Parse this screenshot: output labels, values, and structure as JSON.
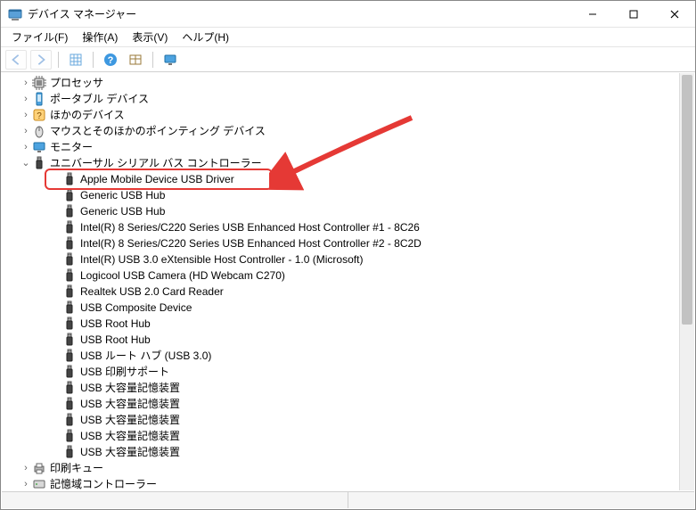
{
  "window": {
    "title": "デバイス マネージャー"
  },
  "menu": {
    "file": "ファイル(F)",
    "action": "操作(A)",
    "view": "表示(V)",
    "help": "ヘルプ(H)"
  },
  "toolbar_icons": {
    "back": "back-arrow",
    "fwd": "forward-arrow",
    "grid": "grid-icon",
    "help": "help-icon",
    "grid2": "grid2-icon",
    "monitor": "monitor-icon"
  },
  "tree": {
    "items": [
      {
        "expander": "collapsed",
        "icon": "cpu-icon",
        "label": "プロセッサ"
      },
      {
        "expander": "collapsed",
        "icon": "portable-icon",
        "label": "ポータブル デバイス"
      },
      {
        "expander": "collapsed",
        "icon": "unknown-icon",
        "label": "ほかのデバイス"
      },
      {
        "expander": "collapsed",
        "icon": "mouse-icon",
        "label": "マウスとそのほかのポインティング デバイス"
      },
      {
        "expander": "collapsed",
        "icon": "monitor-icon",
        "label": "モニター"
      },
      {
        "expander": "expanded",
        "icon": "usb-icon",
        "label": "ユニバーサル シリアル バス コントローラー",
        "children": [
          {
            "icon": "usb-icon",
            "label": "Apple Mobile Device USB Driver",
            "highlight": true
          },
          {
            "icon": "usb-icon",
            "label": "Generic USB Hub"
          },
          {
            "icon": "usb-icon",
            "label": "Generic USB Hub"
          },
          {
            "icon": "usb-icon",
            "label": "Intel(R) 8 Series/C220 Series USB Enhanced Host Controller #1 - 8C26"
          },
          {
            "icon": "usb-icon",
            "label": "Intel(R) 8 Series/C220 Series USB Enhanced Host Controller #2 - 8C2D"
          },
          {
            "icon": "usb-icon",
            "label": "Intel(R) USB 3.0 eXtensible Host Controller - 1.0 (Microsoft)"
          },
          {
            "icon": "usb-icon",
            "label": "Logicool USB Camera (HD Webcam C270)"
          },
          {
            "icon": "usb-icon",
            "label": "Realtek USB 2.0 Card Reader"
          },
          {
            "icon": "usb-icon",
            "label": "USB Composite Device"
          },
          {
            "icon": "usb-icon",
            "label": "USB Root Hub"
          },
          {
            "icon": "usb-icon",
            "label": "USB Root Hub"
          },
          {
            "icon": "usb-icon",
            "label": "USB ルート ハブ (USB 3.0)"
          },
          {
            "icon": "usb-icon",
            "label": "USB 印刷サポート"
          },
          {
            "icon": "usb-icon",
            "label": "USB 大容量記憶装置"
          },
          {
            "icon": "usb-icon",
            "label": "USB 大容量記憶装置"
          },
          {
            "icon": "usb-icon",
            "label": "USB 大容量記憶装置"
          },
          {
            "icon": "usb-icon",
            "label": "USB 大容量記憶装置"
          },
          {
            "icon": "usb-icon",
            "label": "USB 大容量記憶装置"
          }
        ]
      },
      {
        "expander": "collapsed",
        "icon": "printer-icon",
        "label": "印刷キュー"
      },
      {
        "expander": "collapsed",
        "icon": "storage-icon",
        "label": "記憶域コントローラー"
      }
    ]
  },
  "annotation": {
    "arrow_color": "#e53935",
    "highlight_color": "#e53935"
  }
}
